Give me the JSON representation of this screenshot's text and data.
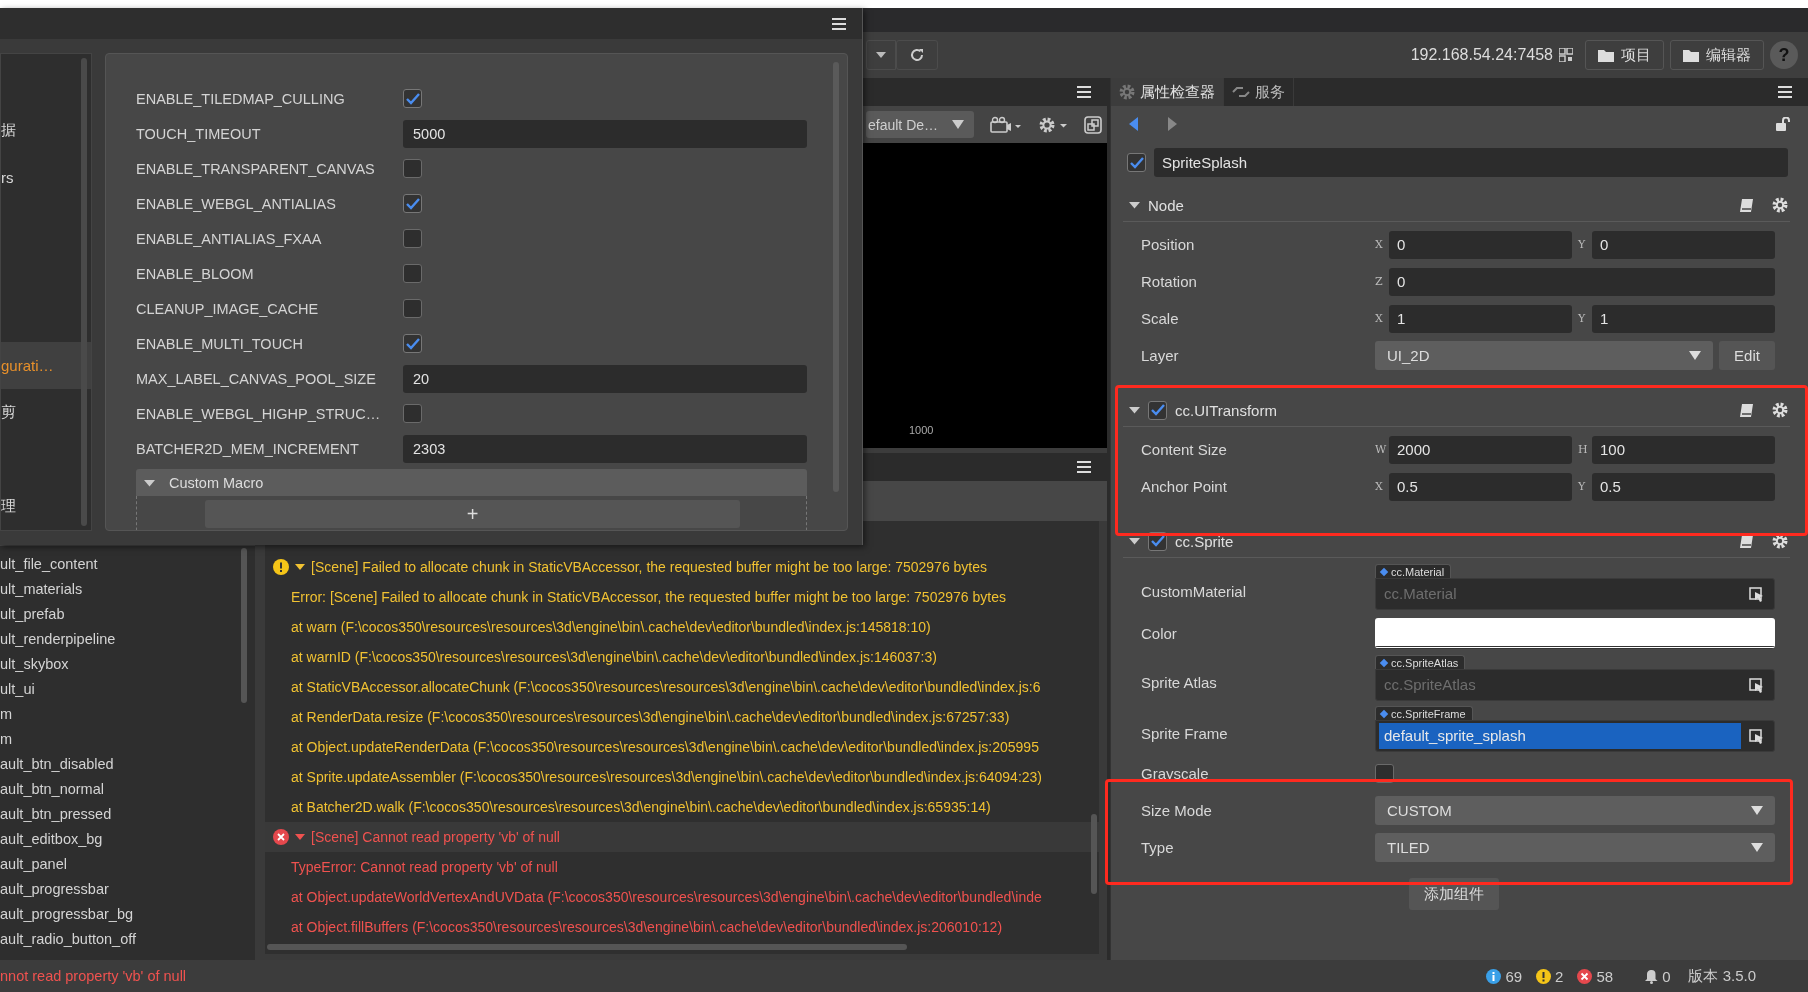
{
  "toolbar": {
    "address": "192.168.54.24:7458",
    "buttons": [
      "项目",
      "编辑器"
    ],
    "help_label": "?"
  },
  "settings_dialog": {
    "nav": [
      {
        "label": "据",
        "selected": false
      },
      {
        "label": "rs",
        "selected": false
      },
      {
        "label": "gurati…",
        "selected": true
      },
      {
        "label": "剪",
        "selected": false
      },
      {
        "label": "理",
        "selected": false
      }
    ],
    "options": [
      {
        "name": "ENABLE_TILEDMAP_CULLING",
        "kind": "checkbox",
        "checked": true
      },
      {
        "name": "TOUCH_TIMEOUT",
        "kind": "number",
        "value": "5000"
      },
      {
        "name": "ENABLE_TRANSPARENT_CANVAS",
        "kind": "checkbox",
        "checked": false
      },
      {
        "name": "ENABLE_WEBGL_ANTIALIAS",
        "kind": "checkbox",
        "checked": true
      },
      {
        "name": "ENABLE_ANTIALIAS_FXAA",
        "kind": "checkbox",
        "checked": false
      },
      {
        "name": "ENABLE_BLOOM",
        "kind": "checkbox",
        "checked": false
      },
      {
        "name": "CLEANUP_IMAGE_CACHE",
        "kind": "checkbox",
        "checked": false
      },
      {
        "name": "ENABLE_MULTI_TOUCH",
        "kind": "checkbox",
        "checked": true
      },
      {
        "name": "MAX_LABEL_CANVAS_POOL_SIZE",
        "kind": "number",
        "value": "20"
      },
      {
        "name": "ENABLE_WEBGL_HIGHP_STRUC…",
        "kind": "checkbox",
        "checked": false
      },
      {
        "name": "BATCHER2D_MEM_INCREMENT",
        "kind": "number",
        "value": "2303"
      }
    ],
    "custom_macro": {
      "title": "Custom Macro",
      "expanded": true,
      "add_label": "+"
    }
  },
  "assets": [
    "ult_file_content",
    "ult_materials",
    "ult_prefab",
    "ult_renderpipeline",
    "ult_skybox",
    "ult_ui",
    "m",
    "m",
    "ault_btn_disabled",
    "ault_btn_normal",
    "ault_btn_pressed",
    "ault_editbox_bg",
    "ault_panel",
    "ault_progressbar",
    "ault_progressbar_bg",
    "ault_radio_button_off"
  ],
  "scene": {
    "camera_dropdown": "efault De…",
    "viewport_label": "1000"
  },
  "console": {
    "groups": [
      {
        "kind": "warning",
        "expanded": true,
        "message": "[Scene] Failed to allocate chunk in StaticVBAccessor, the requested buffer might be too large: 7502976 bytes",
        "lines": [
          "Error: [Scene] Failed to allocate chunk in StaticVBAccessor, the requested buffer might be too large: 7502976 bytes",
          "at warn (F:\\cocos350\\resources\\resources\\3d\\engine\\bin\\.cache\\dev\\editor\\bundled\\index.js:145818:10)",
          "at warnID (F:\\cocos350\\resources\\resources\\3d\\engine\\bin\\.cache\\dev\\editor\\bundled\\index.js:146037:3)",
          "at StaticVBAccessor.allocateChunk (F:\\cocos350\\resources\\resources\\3d\\engine\\bin\\.cache\\dev\\editor\\bundled\\index.js:6",
          "at RenderData.resize (F:\\cocos350\\resources\\resources\\3d\\engine\\bin\\.cache\\dev\\editor\\bundled\\index.js:67257:33)",
          "at Object.updateRenderData (F:\\cocos350\\resources\\resources\\3d\\engine\\bin\\.cache\\dev\\editor\\bundled\\index.js:205995",
          "at Sprite.updateAssembler (F:\\cocos350\\resources\\resources\\3d\\engine\\bin\\.cache\\dev\\editor\\bundled\\index.js:64094:23)",
          "at Batcher2D.walk (F:\\cocos350\\resources\\resources\\3d\\engine\\bin\\.cache\\dev\\editor\\bundled\\index.js:65935:14)"
        ]
      },
      {
        "kind": "error",
        "expanded": true,
        "message": "[Scene] Cannot read property 'vb' of null",
        "lines": [
          "TypeError: Cannot read property 'vb' of null",
          "at Object.updateWorldVertexAndUVData (F:\\cocos350\\resources\\resources\\3d\\engine\\bin\\.cache\\dev\\editor\\bundled\\inde",
          "at Object.fillBuffers (F:\\cocos350\\resources\\resources\\3d\\engine\\bin\\.cache\\dev\\editor\\bundled\\index.js:206010:12)"
        ]
      }
    ]
  },
  "inspector": {
    "tabs": [
      {
        "label": "属性检查器",
        "selected": true
      },
      {
        "label": "服务",
        "selected": false
      }
    ],
    "node": {
      "enabled": true,
      "name": "SpriteSplash"
    },
    "sections": [
      {
        "title": "Node",
        "expanded": true,
        "rows": [
          {
            "kind": "vec",
            "label": "Position",
            "fields": [
              {
                "axis": "X",
                "value": "0"
              },
              {
                "axis": "Y",
                "value": "0"
              }
            ]
          },
          {
            "kind": "vec",
            "label": "Rotation",
            "fields": [
              {
                "axis": "Z",
                "value": "0"
              }
            ]
          },
          {
            "kind": "vec",
            "label": "Scale",
            "fields": [
              {
                "axis": "X",
                "value": "1"
              },
              {
                "axis": "Y",
                "value": "1"
              }
            ]
          },
          {
            "kind": "select",
            "label": "Layer",
            "value": "UI_2D",
            "button": "Edit"
          }
        ]
      },
      {
        "title": "cc.UITransform",
        "expanded": true,
        "enabled": true,
        "rows": [
          {
            "kind": "vec",
            "label": "Content Size",
            "fields": [
              {
                "axis": "W",
                "value": "2000"
              },
              {
                "axis": "H",
                "value": "100"
              }
            ]
          },
          {
            "kind": "vec",
            "label": "Anchor Point",
            "fields": [
              {
                "axis": "X",
                "value": "0.5"
              },
              {
                "axis": "Y",
                "value": "0.5"
              }
            ]
          }
        ]
      },
      {
        "title": "cc.Sprite",
        "expanded": true,
        "enabled": true,
        "rows": [
          {
            "kind": "asset",
            "label": "CustomMaterial",
            "tag": "cc.Material",
            "placeholder": "cc.Material",
            "selected": false
          },
          {
            "kind": "color",
            "label": "Color",
            "color": "#ffffff"
          },
          {
            "kind": "asset",
            "label": "Sprite Atlas",
            "tag": "cc.SpriteAtlas",
            "placeholder": "cc.SpriteAtlas",
            "selected": false
          },
          {
            "kind": "asset",
            "label": "Sprite Frame",
            "tag": "cc.SpriteFrame",
            "value": "default_sprite_splash",
            "selected": true
          },
          {
            "kind": "checkbox",
            "label": "Grayscale",
            "checked": false
          },
          {
            "kind": "select",
            "label": "Size Mode",
            "value": "CUSTOM"
          },
          {
            "kind": "select",
            "label": "Type",
            "value": "TILED"
          }
        ]
      }
    ],
    "add_button": "添加组件"
  },
  "status_bar": {
    "message": "nnot read property 'vb' of null",
    "info_count": "69",
    "warning_count": "2",
    "error_count": "58",
    "notification_count": "0",
    "version": "版本 3.5.0"
  }
}
